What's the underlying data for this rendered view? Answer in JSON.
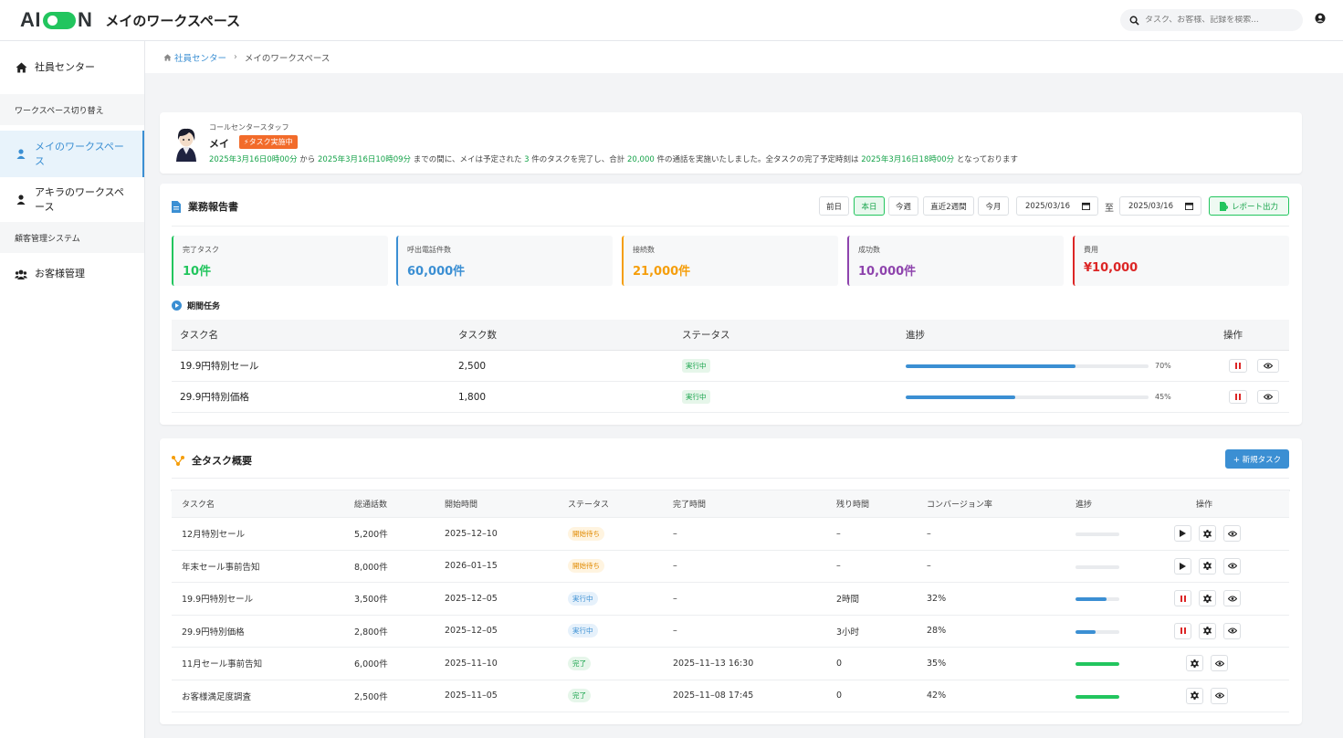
{
  "app": {
    "logo": "AIOON",
    "title": "メイのワークスペース",
    "search_placeholder": "タスク、お客様、記録を検索..."
  },
  "sidebar": {
    "items": [
      {
        "label": "社員センター",
        "icon": "home-icon"
      },
      {
        "section": "ワークスペース切り替え"
      },
      {
        "label": "メイのワークスペース",
        "icon": "user-icon",
        "active": true
      },
      {
        "label": "アキラのワークスペース",
        "icon": "user-icon"
      },
      {
        "section": "顧客管理システム"
      },
      {
        "label": "お客様管理",
        "icon": "users-icon"
      }
    ]
  },
  "breadcrumb": {
    "home": "社員センター",
    "current": "メイのワークスペース"
  },
  "profile": {
    "role": "コールセンタースタッフ",
    "name": "メイ",
    "badge": "タスク実施中",
    "summary": {
      "start": "2025年3月16日0時00分",
      "t1": "から",
      "end": "2025年3月16日10時09分",
      "t2": "までの間に、メイは予定された",
      "tasks": "3",
      "t3": "件のタスクを完了し、合計",
      "calls": "20,000",
      "t4": "件の通話を実施いたしました。全タスクの完了予定時刻は",
      "finish": "2025年3月16日18時00分",
      "t5": "となっております"
    }
  },
  "report": {
    "title": "業務報告書",
    "ranges": [
      "前日",
      "本日",
      "今週",
      "直近2週間",
      "今月"
    ],
    "active_range": "本日",
    "date_from": "2025/03/16",
    "to_label": "至",
    "date_to": "2025/03/16",
    "export_label": "レポート出力",
    "stats": [
      {
        "label": "完了タスク",
        "value": "10件",
        "color": "#22c55e"
      },
      {
        "label": "呼出電話件数",
        "value": "60,000件",
        "color": "#3b8fd3"
      },
      {
        "label": "接続数",
        "value": "21,000件",
        "color": "#f59e0b"
      },
      {
        "label": "成功数",
        "value": "10,000件",
        "color": "#8e44ad"
      },
      {
        "label": "費用",
        "value": "¥10,000",
        "color": "#dc2626"
      }
    ],
    "period_title": "期間任务",
    "table": {
      "headers": [
        "タスク名",
        "タスク数",
        "ステータス",
        "進捗",
        "操作"
      ],
      "rows": [
        {
          "name": "19.9円特別セール",
          "count": "2,500",
          "status": "実行中",
          "progress": 70,
          "progress_label": "70%"
        },
        {
          "name": "29.9円特別価格",
          "count": "1,800",
          "status": "実行中",
          "progress": 45,
          "progress_label": "45%"
        }
      ]
    }
  },
  "overview": {
    "title": "全タスク概要",
    "new_task_label": "+ 新規タスク",
    "headers": [
      "タスク名",
      "総通話数",
      "開始時間",
      "ステータス",
      "完了時間",
      "残り時間",
      "コンバージョン率",
      "進捗",
      "操作"
    ],
    "rows": [
      {
        "name": "12月特別セール",
        "calls": "5,200件",
        "start": "2025–12–10",
        "status": "開始待ち",
        "status_type": "wait",
        "end": "–",
        "remain": "–",
        "rate": "–",
        "progress": 0,
        "actions": [
          "play",
          "gear",
          "eye"
        ]
      },
      {
        "name": "年末セール事前告知",
        "calls": "8,000件",
        "start": "2026–01–15",
        "status": "開始待ち",
        "status_type": "wait",
        "end": "–",
        "remain": "–",
        "rate": "–",
        "progress": 0,
        "actions": [
          "play",
          "gear",
          "eye"
        ]
      },
      {
        "name": "19.9円特別セール",
        "calls": "3,500件",
        "start": "2025–12–05",
        "status": "実行中",
        "status_type": "run",
        "end": "–",
        "remain": "2時間",
        "rate": "32%",
        "progress": 70,
        "actions": [
          "pause",
          "gear",
          "eye"
        ]
      },
      {
        "name": "29.9円特別価格",
        "calls": "2,800件",
        "start": "2025–12–05",
        "status": "実行中",
        "status_type": "run",
        "end": "–",
        "remain": "3小时",
        "rate": "28%",
        "progress": 45,
        "actions": [
          "pause",
          "gear",
          "eye"
        ]
      },
      {
        "name": "11月セール事前告知",
        "calls": "6,000件",
        "start": "2025–11–10",
        "status": "完了",
        "status_type": "done",
        "end": "2025–11–13 16:30",
        "remain": "0",
        "rate": "35%",
        "progress": 100,
        "actions": [
          "gear",
          "eye"
        ]
      },
      {
        "name": "お客様満足度調査",
        "calls": "2,500件",
        "start": "2025–11–05",
        "status": "完了",
        "status_type": "done",
        "end": "2025–11–08 17:45",
        "remain": "0",
        "rate": "42%",
        "progress": 100,
        "actions": [
          "gear",
          "eye"
        ]
      }
    ]
  },
  "colors": {
    "accent_blue": "#3b8fd3",
    "accent_green": "#22c55e",
    "badge_orange": "#f26b2a"
  }
}
